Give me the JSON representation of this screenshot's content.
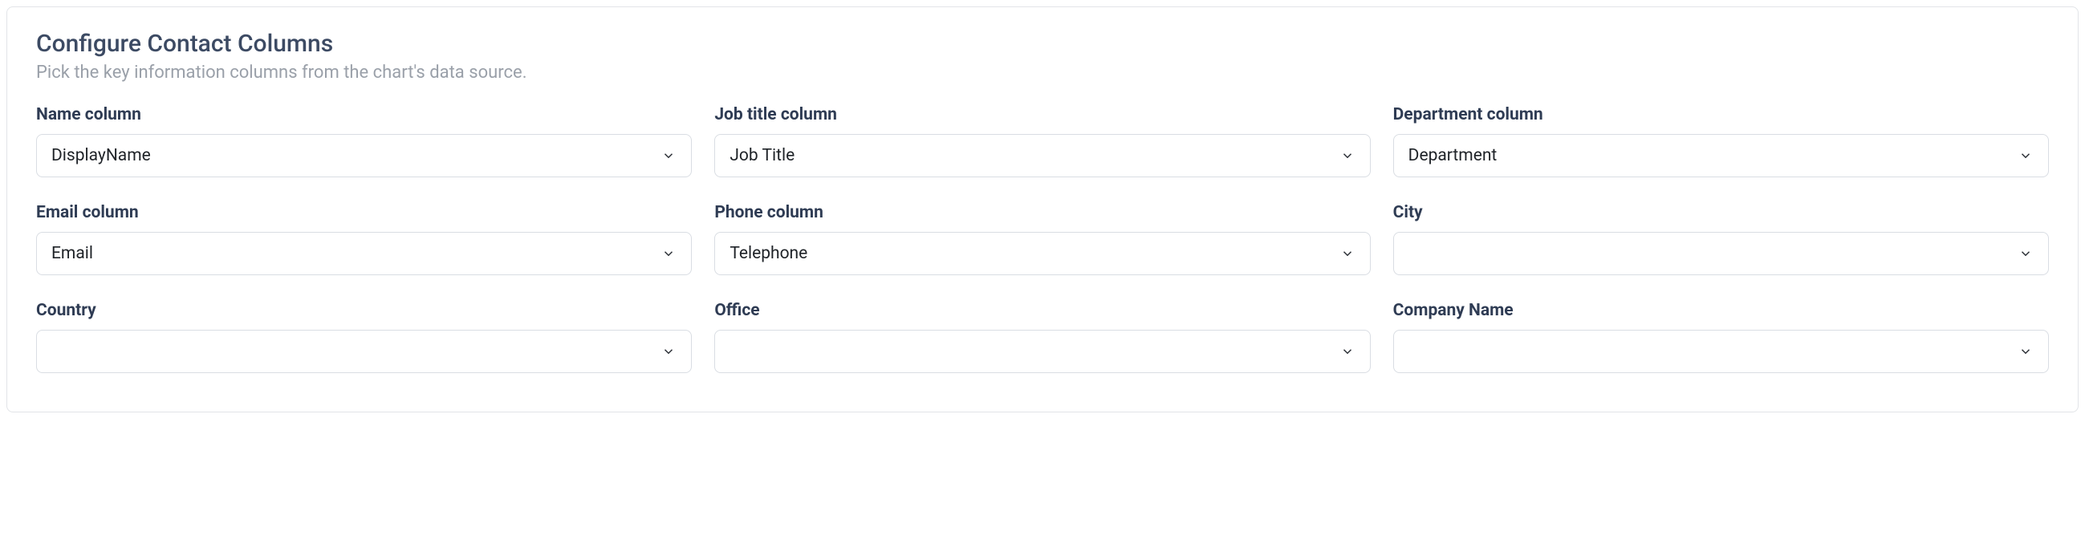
{
  "panel": {
    "title": "Configure Contact Columns",
    "subtitle": "Pick the key information columns from the chart's data source."
  },
  "fields": {
    "name": {
      "label": "Name column",
      "value": "DisplayName"
    },
    "jobTitle": {
      "label": "Job title column",
      "value": "Job Title"
    },
    "department": {
      "label": "Department column",
      "value": "Department"
    },
    "email": {
      "label": "Email column",
      "value": "Email"
    },
    "phone": {
      "label": "Phone column",
      "value": "Telephone"
    },
    "city": {
      "label": "City",
      "value": ""
    },
    "country": {
      "label": "Country",
      "value": ""
    },
    "office": {
      "label": "Office",
      "value": ""
    },
    "company": {
      "label": "Company Name",
      "value": ""
    }
  }
}
